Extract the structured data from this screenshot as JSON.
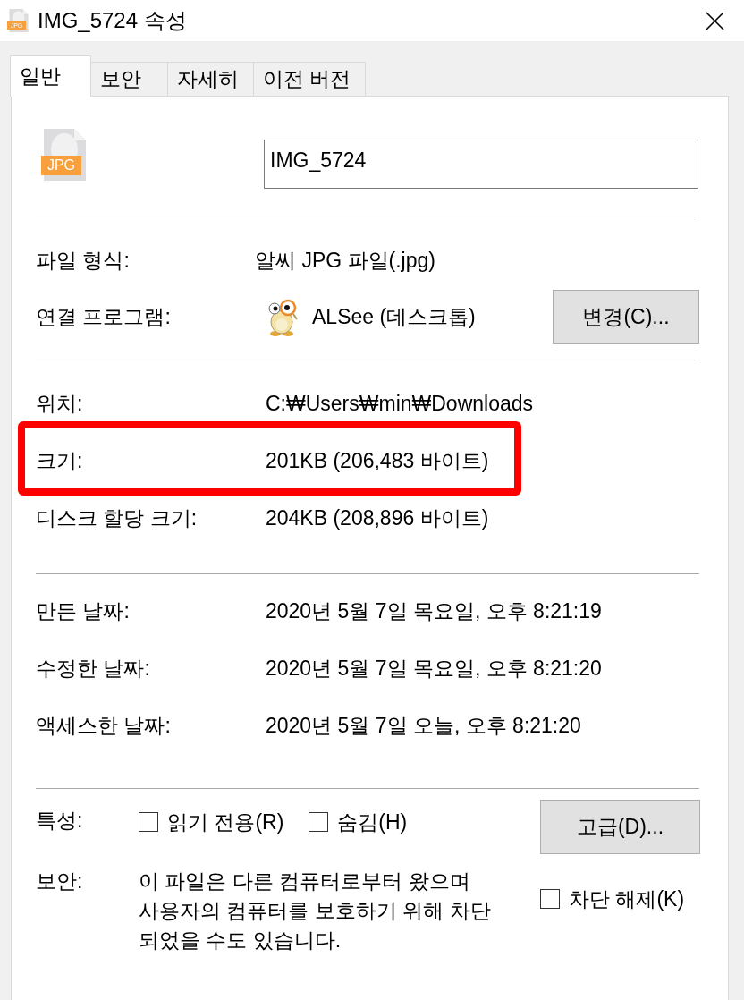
{
  "window": {
    "title": "IMG_5724 속성",
    "icon_badge": "JPG"
  },
  "tabs": [
    {
      "label": "일반",
      "selected": true
    },
    {
      "label": "보안",
      "selected": false
    },
    {
      "label": "자세히",
      "selected": false
    },
    {
      "label": "이전 버전",
      "selected": false
    }
  ],
  "file": {
    "icon_badge": "JPG",
    "name": "IMG_5724"
  },
  "file_type": {
    "label": "파일 형식:",
    "value": "알씨 JPG 파일(.jpg)"
  },
  "opens_with": {
    "label": "연결 프로그램:",
    "app": "ALSee (데스크톱)",
    "button": "변경(C)..."
  },
  "location_rows": [
    {
      "label": "위치:",
      "value": "C:₩Users₩min₩Downloads",
      "highlighted": false
    },
    {
      "label": "크기:",
      "value": "201KB (206,483 바이트)",
      "highlighted": true
    },
    {
      "label": "디스크 할당 크기:",
      "value": "204KB (208,896 바이트)",
      "highlighted": false
    }
  ],
  "date_rows": [
    {
      "label": "만든 날짜:",
      "value": "2020년 5월 7일 목요일, 오후 8:21:19"
    },
    {
      "label": "수정한 날짜:",
      "value": "2020년 5월 7일 목요일, 오후 8:21:20"
    },
    {
      "label": "액세스한 날짜:",
      "value": "2020년 5월 7일 오늘, 오후 8:21:20"
    }
  ],
  "attributes": {
    "label": "특성:",
    "checkboxes": [
      {
        "label": "읽기 전용(R)",
        "checked": false
      },
      {
        "label": "숨김(H)",
        "checked": false
      }
    ],
    "button": "고급(D)..."
  },
  "security": {
    "label": "보안:",
    "text_lines": [
      "이 파일은 다른 컴퓨터로부터 왔으며",
      "사용자의 컴퓨터를 보호하기 위해 차단",
      "되었을 수도 있습니다."
    ],
    "checkbox": {
      "label": "차단 해제(K)",
      "checked": false
    }
  }
}
